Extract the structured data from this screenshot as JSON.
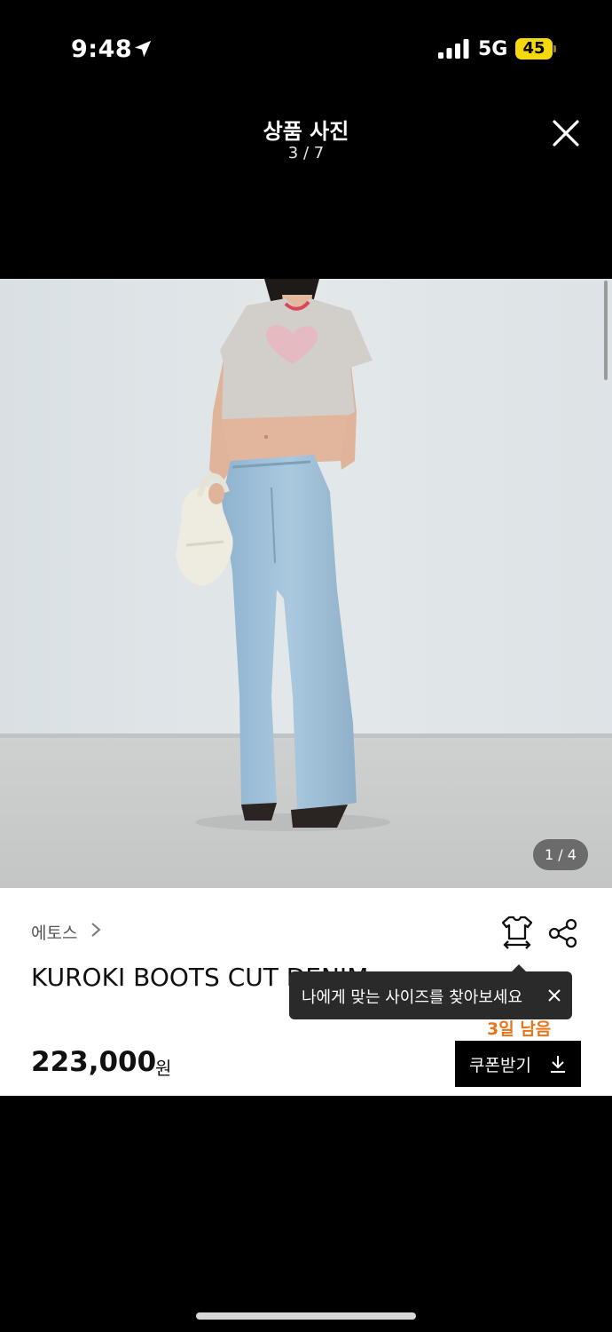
{
  "status_bar": {
    "time": "9:48",
    "network": "5G",
    "battery": "45",
    "battery_color": "#f5d90a"
  },
  "viewer": {
    "title": "상품 사진",
    "counter": "3 / 7",
    "close_icon": "close-icon"
  },
  "photo": {
    "counter": "1 / 4",
    "description_icons": [
      "location-arrow-icon",
      "signal-icon",
      "battery-icon"
    ]
  },
  "product": {
    "brand": "에토스",
    "name": "KUROKI BOOTS CUT DENIM",
    "deadline": "3일 남음",
    "price": "223,000",
    "currency": "원",
    "coupon_label": "쿠폰받기",
    "accent_color": "#e8751a"
  },
  "tooltip": {
    "text": "나에게 맞는 사이즈를 찾아보세요"
  }
}
